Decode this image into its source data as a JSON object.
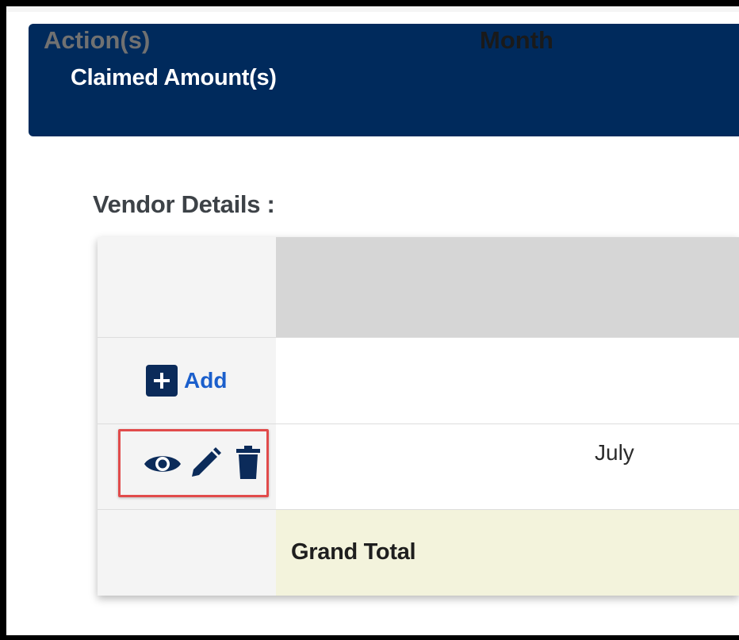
{
  "header": {
    "title": "Claimed Amount(s)"
  },
  "section": {
    "label": "Vendor Details :"
  },
  "table": {
    "columns": [
      "Action(s)",
      "Month"
    ],
    "add_label": "Add",
    "rows": [
      {
        "month": "July",
        "actions": [
          "view-icon",
          "edit-icon",
          "delete-icon"
        ]
      }
    ],
    "grand_total_label": "Grand Total"
  },
  "colors": {
    "header_bg": "#002a5c",
    "accent_link": "#1b5fcc",
    "icon_color": "#0b2b5a",
    "highlight_border": "#e14b4b",
    "total_row_bg": "#f3f3dc",
    "table_header_bg": "#d6d6d6"
  }
}
